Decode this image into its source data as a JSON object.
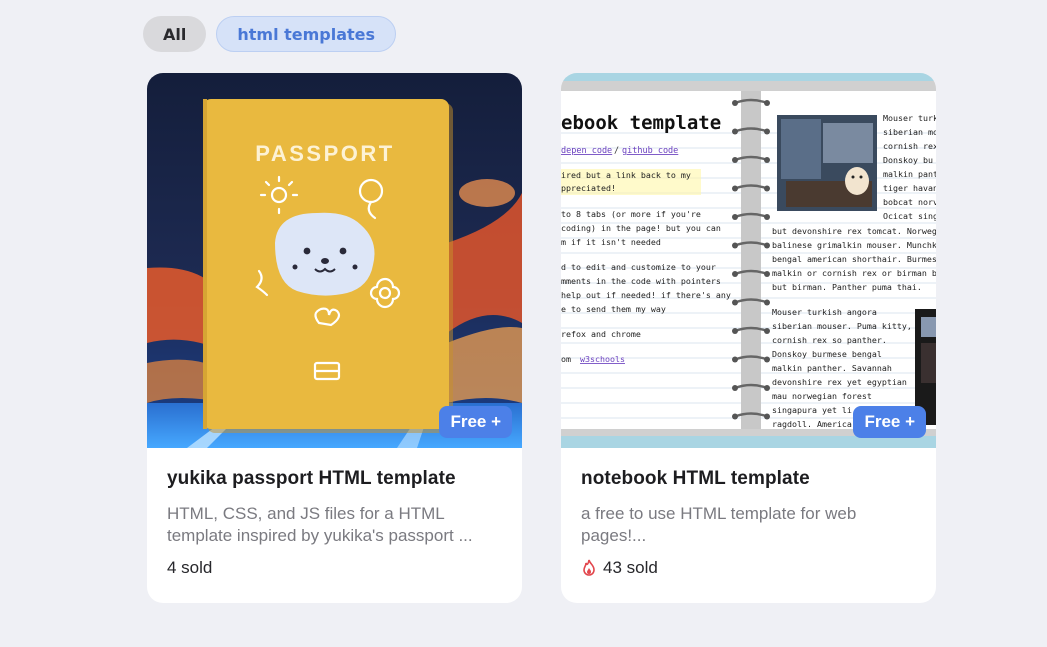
{
  "filters": {
    "all_label": "All",
    "tag_label": "html templates"
  },
  "cards": [
    {
      "title": "yukika passport HTML template",
      "description": "HTML, CSS, and JS files for a HTML template inspired by yukika's passport ...",
      "sold": "4 sold",
      "price_badge": "Free +",
      "thumbnail": {
        "cover_text": "PASSPORT"
      }
    },
    {
      "title": "notebook HTML template",
      "description": "a free to use HTML template for web pages!...",
      "sold": "43 sold",
      "price_badge": "Free +",
      "trending_icon": "flame-icon",
      "thumbnail": {
        "heading": "ebook template",
        "links": [
          "depen code",
          "github code"
        ],
        "left_lines": [
          "ired but a link back to my",
          "ppreciated!",
          "to 8 tabs (or more if you're",
          "coding) in the page! but you can",
          "m if it isn't needed",
          "d to edit and customize to your",
          "mments in the code with pointers",
          "help out if needed! if there's any",
          "e to send them my way",
          "refox and chrome",
          "om"
        ],
        "w3_link": "w3schools",
        "right_lines_a": [
          "Mouser turk",
          "siberian mo",
          "cornish rex",
          "Donskoy bu",
          "malkin pant",
          "tiger havan",
          "bobcat norv",
          "Ocicat sing"
        ],
        "right_lines_b": [
          "but devonshire rex tomcat. Norweg",
          "balinese grimalkin mouser. Munchki",
          "bengal american shorthair. Burmes",
          "malkin or cornish rex or birman bu",
          "but birman. Panther puma thai."
        ],
        "right_lines_c": [
          "Mouser turkish angora",
          "siberian mouser. Puma kitty,",
          "cornish rex so panther.",
          "Donskoy burmese bengal",
          "malkin panther. Savannah",
          "devonshire rex yet egyptian",
          "mau norwegian forest",
          "singapura yet li",
          "ragdoll. America"
        ]
      }
    }
  ],
  "colors": {
    "page_bg": "#eff0f5",
    "accent": "#4c80e8",
    "passport": "#e9b93f",
    "flame": "#e2474d"
  }
}
